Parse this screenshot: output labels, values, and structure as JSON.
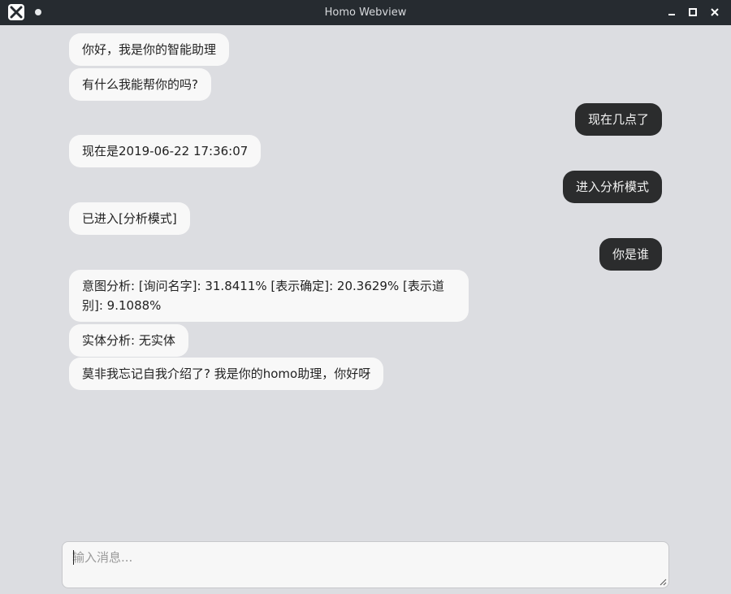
{
  "window": {
    "title": "Homo Webview",
    "icons": [
      "app-x-icon",
      "menu-dot-icon",
      "minimize-icon",
      "maximize-icon",
      "close-icon"
    ]
  },
  "messages": [
    {
      "from": "bot",
      "text": "你好，我是你的智能助理"
    },
    {
      "from": "bot",
      "text": "有什么我能帮你的吗?"
    },
    {
      "from": "user",
      "text": "现在几点了"
    },
    {
      "from": "bot",
      "text": "现在是2019-06-22 17:36:07"
    },
    {
      "from": "user",
      "text": "进入分析模式"
    },
    {
      "from": "bot",
      "text": "已进入[分析模式]"
    },
    {
      "from": "user",
      "text": "你是谁"
    },
    {
      "from": "bot",
      "text": "意图分析: [询问名字]: 31.8411% [表示确定]: 20.3629% [表示道别]: 9.1088%"
    },
    {
      "from": "bot",
      "text": "实体分析: 无实体"
    },
    {
      "from": "bot",
      "text": "莫非我忘记自我介绍了? 我是你的homo助理，你好呀"
    }
  ],
  "composer": {
    "placeholder": "输入消息...",
    "value": ""
  },
  "colors": {
    "background": "#dcdde1",
    "titlebar": "#262b30",
    "bot_bubble": "#f8f8f8",
    "user_bubble": "#2b2c2d"
  }
}
